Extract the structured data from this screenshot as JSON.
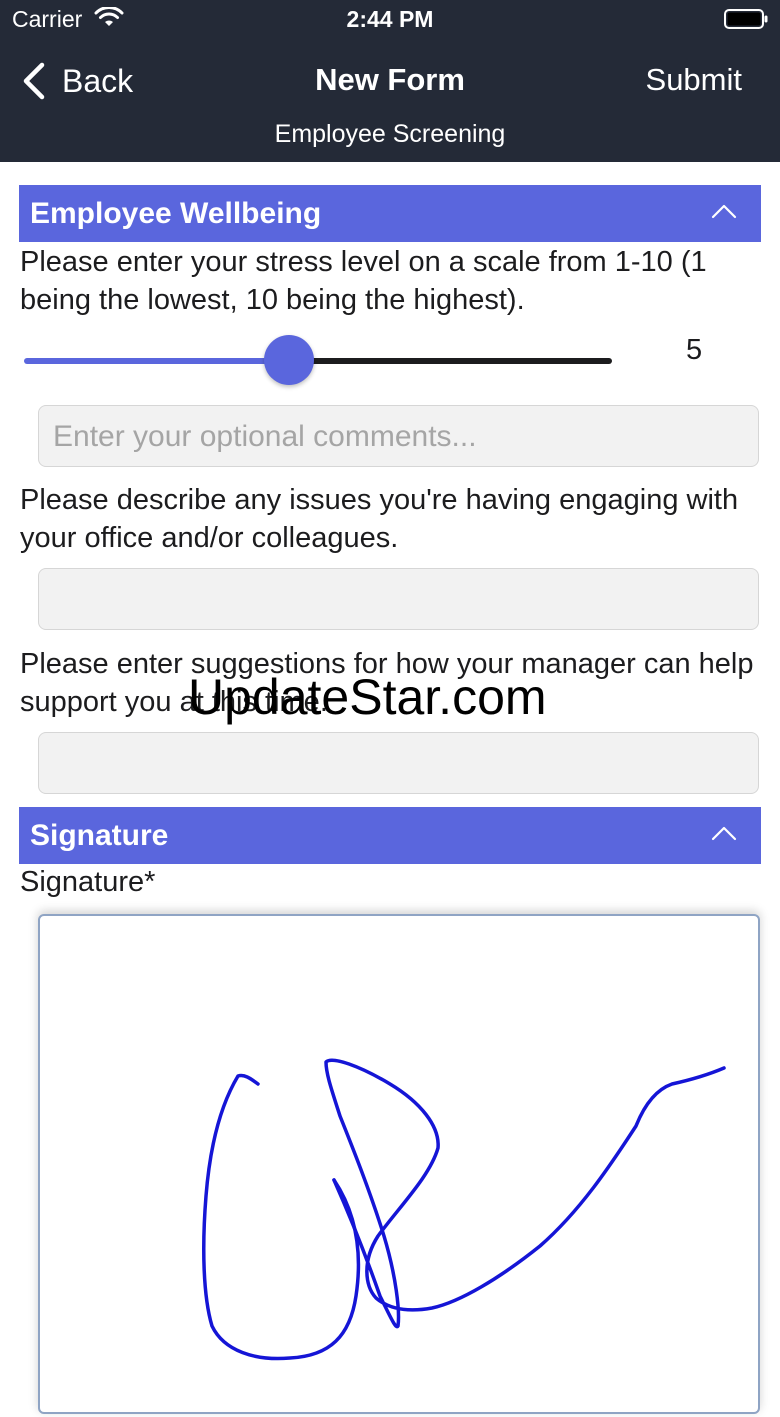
{
  "status_bar": {
    "carrier": "Carrier",
    "time": "2:44 PM"
  },
  "nav": {
    "back_label": "Back",
    "title": "New Form",
    "submit_label": "Submit",
    "subtitle": "Employee Screening"
  },
  "sections": {
    "wellbeing": {
      "title": "Employee Wellbeing",
      "stress_question": "Please enter your stress level on a scale from 1-10 (1 being the lowest, 10 being the highest).",
      "stress_value": "5",
      "stress_min": 1,
      "stress_max": 10,
      "comments_placeholder": "Enter your optional comments...",
      "issues_question": "Please describe any issues you're having engaging with your office and/or colleagues.",
      "issues_value": "",
      "support_question": "Please enter suggestions for how your manager can help support you at this time.",
      "support_value": ""
    },
    "signature": {
      "title": "Signature",
      "field_label": "Signature*"
    }
  },
  "watermark": "UpdateStar.com",
  "colors": {
    "nav_bg": "#242a37",
    "accent": "#5a66dd",
    "signature_ink": "#1515d6"
  },
  "icons": {
    "back": "chevron-left-icon",
    "collapse": "chevron-up-icon",
    "wifi": "wifi-icon",
    "battery": "battery-icon"
  }
}
